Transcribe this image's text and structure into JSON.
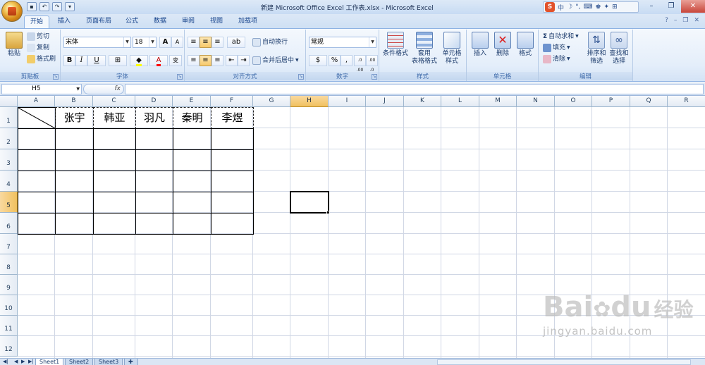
{
  "window": {
    "title": "新建 Microsoft Office Excel 工作表.xlsx - Microsoft Excel",
    "ime_label": "中"
  },
  "tabs": [
    "开始",
    "插入",
    "页面布局",
    "公式",
    "数据",
    "审阅",
    "视图",
    "加载项"
  ],
  "ribbon": {
    "clipboard": {
      "paste": "粘贴",
      "cut": "剪切",
      "copy": "复制",
      "format_painter": "格式刷",
      "label": "剪贴板"
    },
    "font": {
      "name": "宋体",
      "size": "18",
      "bold": "B",
      "italic": "I",
      "underline": "U",
      "label": "字体",
      "grow": "A",
      "shrink": "A",
      "wen": "变"
    },
    "alignment": {
      "wrap": "自动换行",
      "merge": "合并后居中",
      "label": "对齐方式"
    },
    "number": {
      "format": "常规",
      "percent": "%",
      "comma": ",",
      "label": "数字",
      "inc": ".0 .00",
      "dec": ".00 .0"
    },
    "styles": {
      "conditional": "条件格式",
      "table_format_1": "套用",
      "table_format_2": "表格格式",
      "cell_style_1": "单元格",
      "cell_style_2": "样式",
      "label": "样式"
    },
    "cells": {
      "insert": "插入",
      "delete": "删除",
      "format": "格式",
      "label": "单元格"
    },
    "editing": {
      "autosum": "自动求和",
      "fill": "填充",
      "clear": "清除",
      "sort_1": "排序和",
      "sort_2": "筛选",
      "find_1": "查找和",
      "find_2": "选择",
      "label": "编辑"
    }
  },
  "formula_bar": {
    "name_box": "H5",
    "fx": "fx",
    "value": ""
  },
  "columns": [
    "A",
    "B",
    "C",
    "D",
    "E",
    "F",
    "G",
    "H",
    "I",
    "J",
    "K",
    "L",
    "M",
    "N",
    "O",
    "P",
    "Q",
    "R"
  ],
  "rows": [
    "1",
    "2",
    "3",
    "4",
    "5",
    "6",
    "7",
    "8",
    "9",
    "10",
    "11",
    "12"
  ],
  "selected": {
    "column": "H",
    "row": "5"
  },
  "table": {
    "headers": [
      "张宇",
      "韩亚",
      "羽凡",
      "秦明",
      "李煜"
    ]
  },
  "sheets": [
    "Sheet1",
    "Sheet2",
    "Sheet3"
  ],
  "watermark": {
    "brand": "Bai",
    "brand2": "du",
    "cn": "经验",
    "url": "jingyan.baidu.com"
  }
}
